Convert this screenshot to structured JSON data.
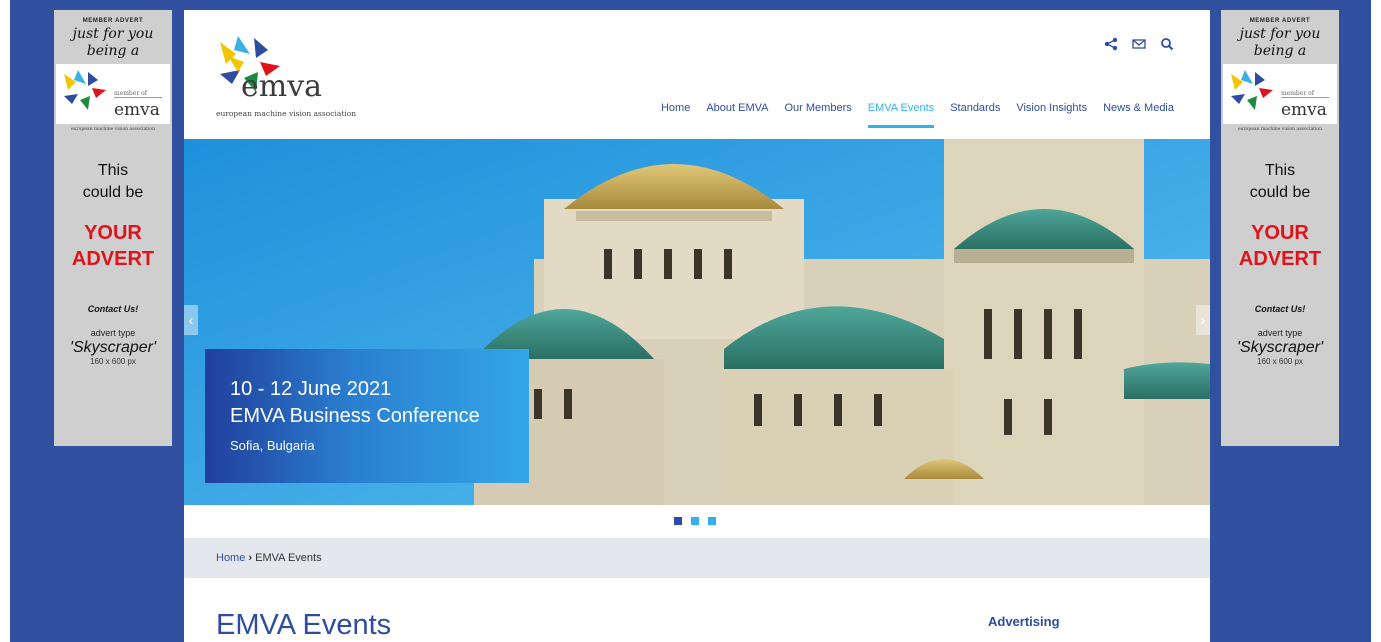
{
  "ads": {
    "left": {
      "tag": "MEMBER ADVERT",
      "script_line1": "just for you",
      "script_line2": "being a",
      "member_of": "member of",
      "emva": "emva",
      "assoc": "european machine vision association",
      "this_line1": "This",
      "this_line2": "could be",
      "your": "YOUR",
      "advert": "ADVERT",
      "contact": "Contact Us!",
      "type_label": "advert type",
      "type_value": "'Skyscraper'",
      "dims": "160 x 600 px"
    },
    "right": {
      "tag": "MEMBER ADVERT",
      "script_line1": "just for you",
      "script_line2": "being a",
      "member_of": "member of",
      "emva": "emva",
      "assoc": "european machine vision association",
      "this_line1": "This",
      "this_line2": "could be",
      "your": "YOUR",
      "advert": "ADVERT",
      "contact": "Contact Us!",
      "type_label": "advert type",
      "type_value": "'Skyscraper'",
      "dims": "160 x 600 px"
    }
  },
  "logo": {
    "wordmark": "emva",
    "subtitle": "european machine vision association"
  },
  "header_icons": [
    "share-icon",
    "mail-icon",
    "search-icon"
  ],
  "nav": [
    {
      "label": "Home",
      "active": false
    },
    {
      "label": "About EMVA",
      "active": false
    },
    {
      "label": "Our Members",
      "active": false
    },
    {
      "label": "EMVA Events",
      "active": true
    },
    {
      "label": "Standards",
      "active": false
    },
    {
      "label": "Vision Insights",
      "active": false
    },
    {
      "label": "News & Media",
      "active": false
    }
  ],
  "hero": {
    "date": "10 - 12 June 2021",
    "title": "EMVA Business Conference",
    "place": "Sofia, Bulgaria",
    "prev_arrow": "‹",
    "next_arrow": "›",
    "slide_count": 3,
    "active_slide": 1
  },
  "breadcrumb": {
    "home": "Home",
    "separator": "›",
    "current": "EMVA Events"
  },
  "page_title": "EMVA Events",
  "sidebar_heading": "Advertising",
  "colors": {
    "brand_blue": "#2f4da0",
    "accent_cyan": "#32b1e8",
    "page_bg": "#3150a0",
    "advert_red": "#e0131b"
  }
}
